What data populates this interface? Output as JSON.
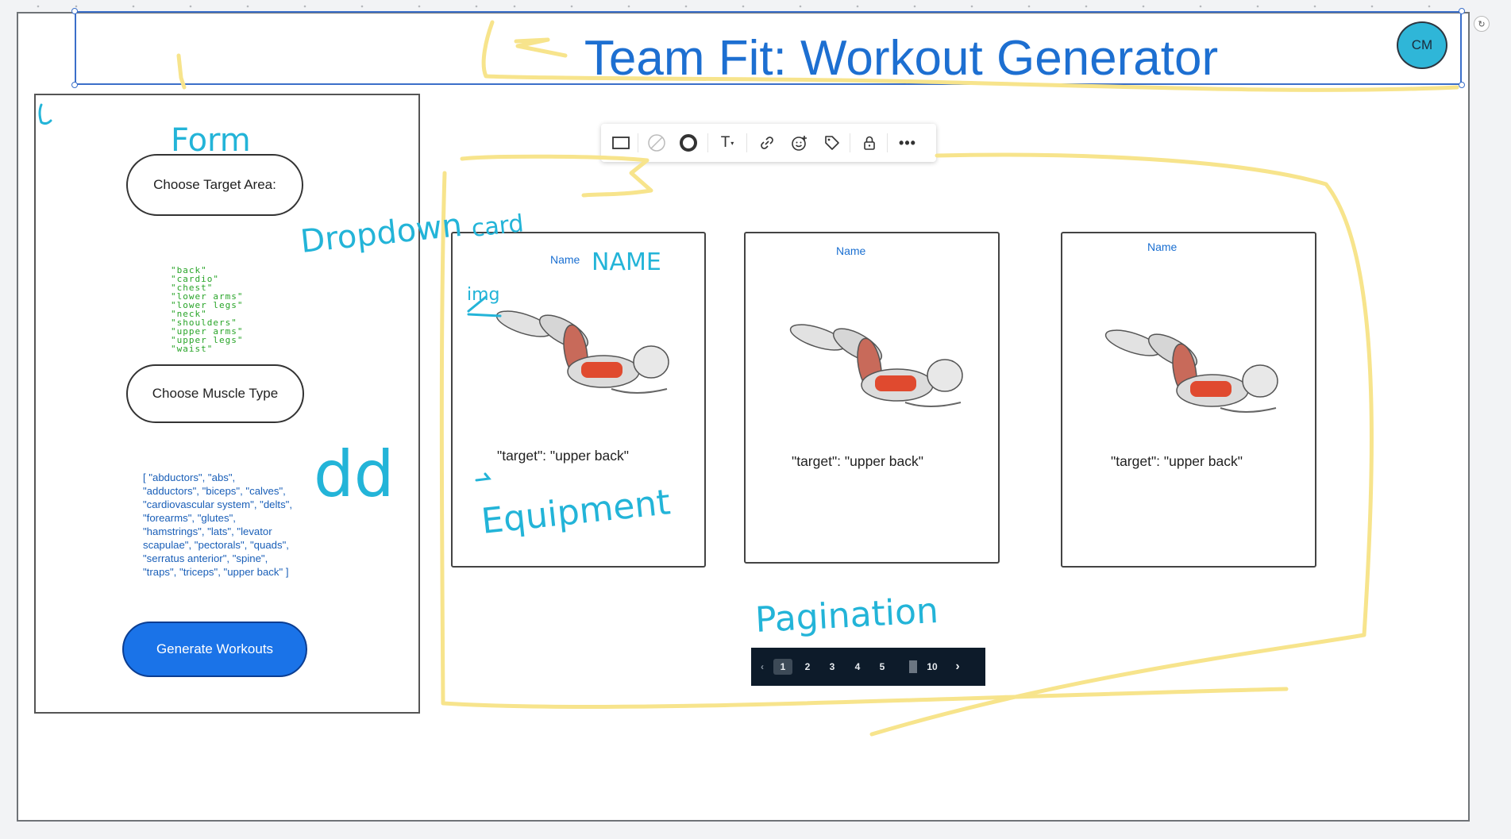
{
  "header": {
    "title": "Team Fit: Workout Generator",
    "avatar_initials": "CM"
  },
  "form": {
    "target_button": "Choose Target Area:",
    "target_options": [
      "\"back\"",
      "\"cardio\"",
      "\"chest\"",
      "\"lower arms\"",
      "\"lower legs\"",
      "\"neck\"",
      "\"shoulders\"",
      "\"upper arms\"",
      "\"upper legs\"",
      "\"waist\""
    ],
    "muscle_button": "Choose Muscle Type",
    "muscle_list_lines": [
      "[  \"abductors\",  \"abs\",",
      "\"adductors\",  \"biceps\",  \"calves\",",
      "\"cardiovascular system\",  \"delts\",",
      "\"forearms\",  \"glutes\",",
      "\"hamstrings\",  \"lats\",  \"levator",
      "scapulae\",  \"pectorals\",  \"quads\",",
      "\"serratus anterior\",  \"spine\",",
      "\"traps\",  \"triceps\",  \"upper back\" ]"
    ],
    "generate_button": "Generate Workouts"
  },
  "toolbar": {
    "tools": [
      "rectangle-icon",
      "no-fill-icon",
      "stroke-icon",
      "text-size-icon",
      "link-icon",
      "add-reaction-icon",
      "tag-icon",
      "lock-icon",
      "more-icon"
    ],
    "text_tool_label": "T"
  },
  "cards": [
    {
      "name": "Name",
      "target": "\"target\": \"upper back\""
    },
    {
      "name": "Name",
      "target": "\"target\": \"upper back\""
    },
    {
      "name": "Name",
      "target": "\"target\": \"upper back\""
    }
  ],
  "pagination": {
    "prev": "‹",
    "pages": [
      "1",
      "2",
      "3",
      "4",
      "5"
    ],
    "last": "10",
    "next": "›",
    "current": "1"
  },
  "annotations": {
    "form": "Form",
    "dropdown": "Dropdown",
    "card": "card",
    "name": "NAME",
    "img": "img",
    "dd": "dd",
    "equipment": "Equipment",
    "pagination": "Pagination",
    "c": "C"
  },
  "colors": {
    "title_blue": "#1d6fd1",
    "avatar": "#2fb6d8",
    "generate_button": "#1a73e8",
    "pagination_bg": "#0d1b2a",
    "highlighter": "#f7e48c",
    "handwriting": "#23b4d8",
    "target_list": "#28a428"
  }
}
